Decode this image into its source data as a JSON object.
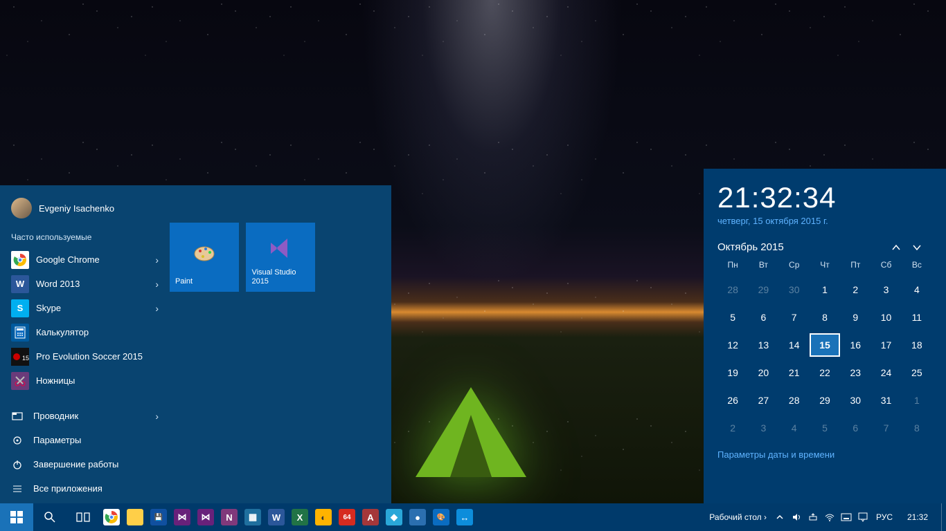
{
  "start": {
    "user_name": "Evgeniy Isachenko",
    "most_used_label": "Часто используемые",
    "apps": [
      {
        "label": "Google Chrome",
        "icon": "chrome",
        "bg": "#fff",
        "has_sub": true
      },
      {
        "label": "Word 2013",
        "icon": "W",
        "bg": "#2b579a",
        "has_sub": true
      },
      {
        "label": "Skype",
        "icon": "S",
        "bg": "#00aff0",
        "has_sub": true
      },
      {
        "label": "Калькулятор",
        "icon": "calc",
        "bg": "#005a9e",
        "has_sub": false
      },
      {
        "label": "Pro Evolution Soccer 2015",
        "icon": "pes",
        "bg": "#111",
        "has_sub": false
      },
      {
        "label": "Ножницы",
        "icon": "snip",
        "bg": "#6a3b7a",
        "has_sub": false
      }
    ],
    "sys": {
      "explorer": "Проводник",
      "settings": "Параметры",
      "power": "Завершение работы",
      "all_apps": "Все приложения"
    },
    "tiles": [
      {
        "label": "Paint",
        "icon": "paint"
      },
      {
        "label": "Visual Studio 2015",
        "icon": "vs"
      }
    ]
  },
  "clock": {
    "big_time": "21:32:34",
    "full_date": "четверг, 15 октября 2015 г.",
    "month_label": "Октябрь 2015",
    "dow": [
      "Пн",
      "Вт",
      "Ср",
      "Чт",
      "Пт",
      "Сб",
      "Вс"
    ],
    "days": [
      {
        "n": "28",
        "o": true
      },
      {
        "n": "29",
        "o": true
      },
      {
        "n": "30",
        "o": true
      },
      {
        "n": "1"
      },
      {
        "n": "2"
      },
      {
        "n": "3"
      },
      {
        "n": "4"
      },
      {
        "n": "5"
      },
      {
        "n": "6"
      },
      {
        "n": "7"
      },
      {
        "n": "8"
      },
      {
        "n": "9"
      },
      {
        "n": "10"
      },
      {
        "n": "11"
      },
      {
        "n": "12"
      },
      {
        "n": "13"
      },
      {
        "n": "14"
      },
      {
        "n": "15",
        "today": true
      },
      {
        "n": "16"
      },
      {
        "n": "17"
      },
      {
        "n": "18"
      },
      {
        "n": "19"
      },
      {
        "n": "20"
      },
      {
        "n": "21"
      },
      {
        "n": "22"
      },
      {
        "n": "23"
      },
      {
        "n": "24"
      },
      {
        "n": "25"
      },
      {
        "n": "26"
      },
      {
        "n": "27"
      },
      {
        "n": "28"
      },
      {
        "n": "29"
      },
      {
        "n": "30"
      },
      {
        "n": "31"
      },
      {
        "n": "1",
        "o": true
      },
      {
        "n": "2",
        "o": true
      },
      {
        "n": "3",
        "o": true
      },
      {
        "n": "4",
        "o": true
      },
      {
        "n": "5",
        "o": true
      },
      {
        "n": "6",
        "o": true
      },
      {
        "n": "7",
        "o": true
      },
      {
        "n": "8",
        "o": true
      }
    ],
    "settings_link": "Параметры даты и времени"
  },
  "taskbar": {
    "apps": [
      {
        "name": "chrome",
        "bg": "#fff",
        "txt": "",
        "glyph": "chrome"
      },
      {
        "name": "file-explorer",
        "bg": "#ffcf48",
        "txt": ""
      },
      {
        "name": "floppy",
        "bg": "#1050a0",
        "txt": "💾"
      },
      {
        "name": "visual-studio",
        "bg": "#68217a",
        "txt": "⋈"
      },
      {
        "name": "visual-studio-blend",
        "bg": "#68217a",
        "txt": "⋈"
      },
      {
        "name": "onenote",
        "bg": "#80397b",
        "txt": "N"
      },
      {
        "name": "calculator",
        "bg": "#1f6f9e",
        "txt": "▦"
      },
      {
        "name": "word",
        "bg": "#2b579a",
        "txt": "W"
      },
      {
        "name": "excel",
        "bg": "#217346",
        "txt": "X"
      },
      {
        "name": "cleaner",
        "bg": "#ffb300",
        "txt": "◐"
      },
      {
        "name": "aida64",
        "bg": "#d62b1f",
        "txt": "64"
      },
      {
        "name": "access",
        "bg": "#a4373a",
        "txt": "A"
      },
      {
        "name": "app1",
        "bg": "#2aa7d8",
        "txt": "◆"
      },
      {
        "name": "app2",
        "bg": "#2b6fb0",
        "txt": "●"
      },
      {
        "name": "paint",
        "bg": "#0a6cc1",
        "txt": "🎨"
      },
      {
        "name": "teamviewer",
        "bg": "#0d8ddb",
        "txt": "↔"
      }
    ],
    "desktop_toolbar": "Рабочий стол",
    "lang": "РУС",
    "time": "21:32"
  }
}
